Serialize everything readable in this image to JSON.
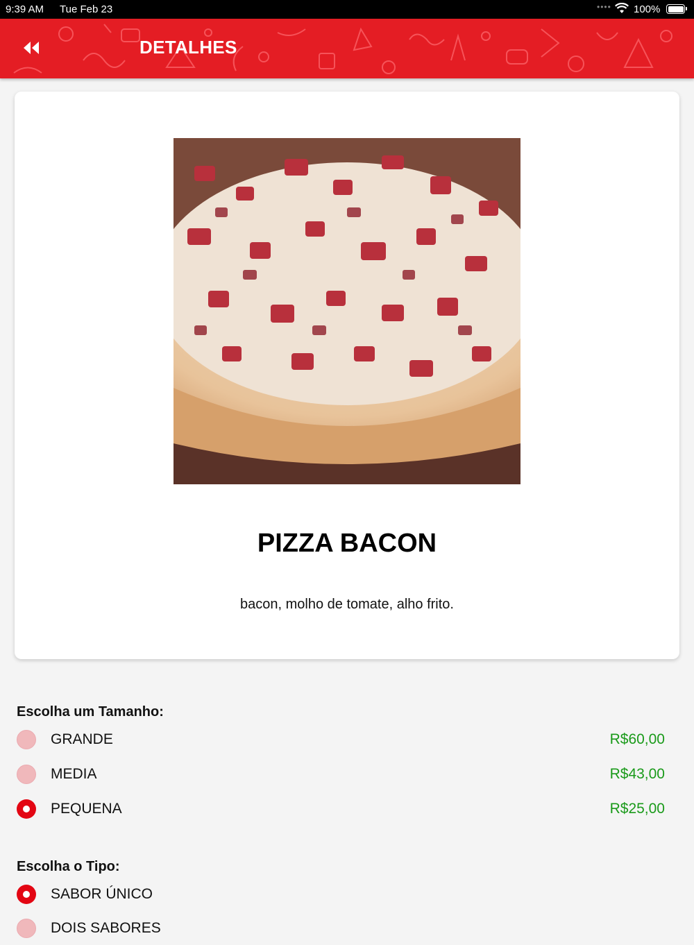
{
  "status_bar": {
    "time": "9:39 AM",
    "date": "Tue Feb 23",
    "battery": "100%"
  },
  "header": {
    "title": "DETALHES",
    "back_icon": "double-chevron-left-icon",
    "background_color": "#e41d24"
  },
  "product": {
    "name": "PIZZA BACON",
    "description": "bacon, molho de tomate, alho frito."
  },
  "size_section": {
    "title": "Escolha um Tamanho:",
    "options": [
      {
        "label": "GRANDE",
        "price": "R$60,00",
        "selected": false
      },
      {
        "label": "MEDIA",
        "price": "R$43,00",
        "selected": false
      },
      {
        "label": "PEQUENA",
        "price": "R$25,00",
        "selected": true
      }
    ]
  },
  "type_section": {
    "title": "Escolha o Tipo:",
    "options": [
      {
        "label": "SABOR ÚNICO",
        "selected": true
      },
      {
        "label": "DOIS SABORES",
        "selected": false
      }
    ]
  },
  "colors": {
    "accent": "#e30613",
    "price": "#1a9a1a",
    "radio_unselected": "#f0b8bb"
  }
}
